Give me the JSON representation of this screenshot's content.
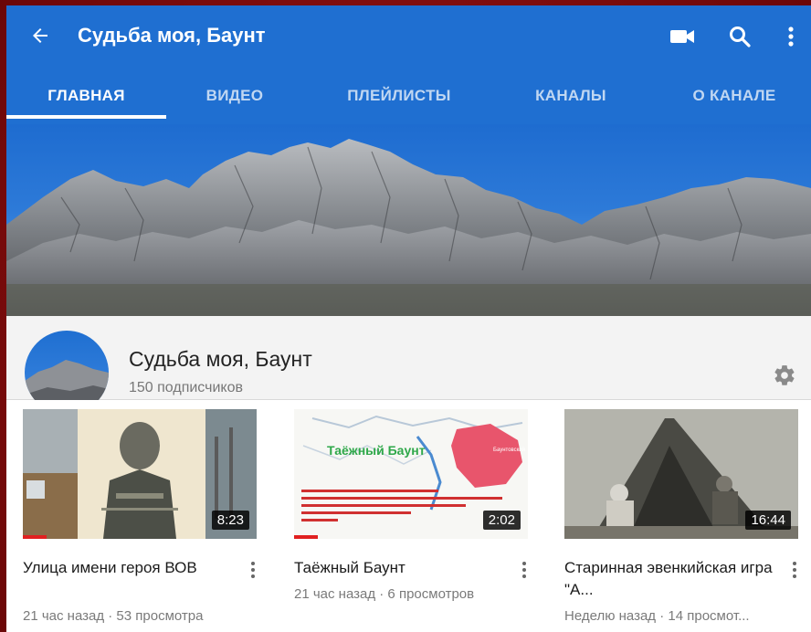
{
  "app_bar": {
    "title": "Судьба моя, Баунт",
    "back_icon": "arrow-left-icon",
    "actions": [
      "video-camera-icon",
      "search-icon",
      "more-vert-icon"
    ],
    "color": "#1f6fd1"
  },
  "tabs": [
    {
      "label": "ГЛАВНАЯ",
      "active": true
    },
    {
      "label": "ВИДЕО",
      "active": false
    },
    {
      "label": "ПЛЕЙЛИСТЫ",
      "active": false
    },
    {
      "label": "КАНАЛЫ",
      "active": false
    },
    {
      "label": "О КАНАЛЕ",
      "active": false
    }
  ],
  "channel": {
    "name": "Судьба моя, Баунт",
    "subscribers": "150 подписчиков",
    "settings_icon": "gear-icon"
  },
  "videos": [
    {
      "title": "Улица имени героя ВОВ",
      "meta": "21 час назад · 53 просмотра",
      "duration": "8:23"
    },
    {
      "title": "Таёжный Баунт",
      "meta": "21 час назад · 6 просмотров",
      "duration": "2:02",
      "thumb_caption": "Таёжный Баунт"
    },
    {
      "title": "Старинная эвенкийская игра \"А...",
      "meta": "Неделю назад · 14 просмот...",
      "duration": "16:44"
    }
  ]
}
